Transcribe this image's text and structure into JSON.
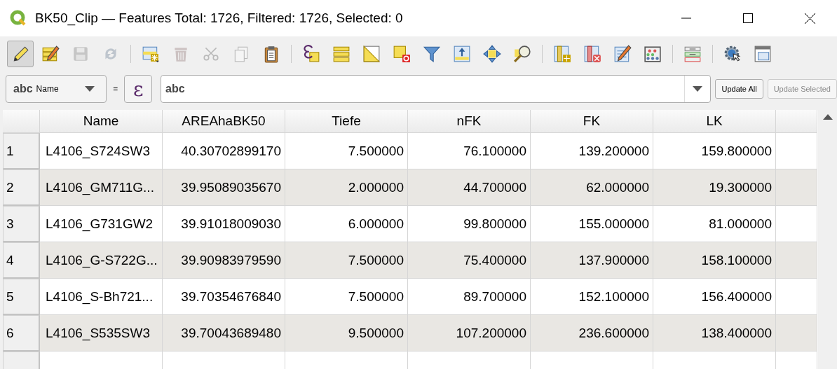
{
  "window": {
    "title": "BK50_Clip — Features Total: 1726, Filtered: 1726, Selected: 0"
  },
  "toolbar": [
    {
      "kind": "edit",
      "on": true,
      "disabled": false
    },
    {
      "kind": "multiedit",
      "on": false,
      "disabled": false
    },
    {
      "kind": "save",
      "on": false,
      "disabled": true
    },
    {
      "kind": "reload",
      "on": false,
      "disabled": true
    },
    {
      "kind": "separator"
    },
    {
      "kind": "newfeature",
      "on": false,
      "disabled": false
    },
    {
      "kind": "delete",
      "on": false,
      "disabled": true
    },
    {
      "kind": "cut",
      "on": false,
      "disabled": true
    },
    {
      "kind": "copy",
      "on": false,
      "disabled": true
    },
    {
      "kind": "paste",
      "on": false,
      "disabled": false
    },
    {
      "kind": "separator"
    },
    {
      "kind": "selectexpr",
      "on": false,
      "disabled": false
    },
    {
      "kind": "selectall",
      "on": false,
      "disabled": false
    },
    {
      "kind": "invert",
      "on": false,
      "disabled": false
    },
    {
      "kind": "deselect",
      "on": false,
      "disabled": false
    },
    {
      "kind": "filter",
      "on": false,
      "disabled": false
    },
    {
      "kind": "movetop",
      "on": false,
      "disabled": false
    },
    {
      "kind": "pan",
      "on": false,
      "disabled": false
    },
    {
      "kind": "zoom",
      "on": false,
      "disabled": false
    },
    {
      "kind": "separator"
    },
    {
      "kind": "addcol",
      "on": false,
      "disabled": false
    },
    {
      "kind": "delcol",
      "on": false,
      "disabled": false
    },
    {
      "kind": "calc",
      "on": false,
      "disabled": false
    },
    {
      "kind": "abacus",
      "on": false,
      "disabled": false
    },
    {
      "kind": "separator"
    },
    {
      "kind": "form",
      "on": false,
      "disabled": false
    },
    {
      "kind": "separator"
    },
    {
      "kind": "actions",
      "on": false,
      "disabled": false
    },
    {
      "kind": "dock",
      "on": false,
      "disabled": false
    }
  ],
  "filter_bar": {
    "field_type": "abc",
    "field": "Name",
    "operator": "=",
    "expression_button": "ε",
    "value": "abc",
    "buttons": [
      {
        "label": "Update All",
        "disabled": false
      },
      {
        "label": "Update Selected",
        "disabled": true
      }
    ]
  },
  "table": {
    "columns": [
      "Name",
      "AREAhaBK50",
      "Tiefe",
      "nFK",
      "FK",
      "LK"
    ],
    "rows": [
      {
        "header": "1",
        "cells": [
          "L4106_S724SW3",
          "40.30702899170",
          "7.500000",
          "76.100000",
          "139.200000",
          "159.800000"
        ]
      },
      {
        "header": "2",
        "cells": [
          "L4106_GM711G...",
          "39.95089035670",
          "2.000000",
          "44.700000",
          "62.000000",
          "19.300000"
        ]
      },
      {
        "header": "3",
        "cells": [
          "L4106_G731GW2",
          "39.91018009030",
          "6.000000",
          "99.800000",
          "155.000000",
          "81.000000"
        ]
      },
      {
        "header": "4",
        "cells": [
          "L4106_G-S722G...",
          "39.90983979590",
          "7.500000",
          "75.400000",
          "137.900000",
          "158.100000"
        ]
      },
      {
        "header": "5",
        "cells": [
          "L4106_S-Bh721...",
          "39.70354676840",
          "7.500000",
          "89.700000",
          "152.100000",
          "156.400000"
        ]
      },
      {
        "header": "6",
        "cells": [
          "L4106_S535SW3",
          "39.70043689480",
          "9.500000",
          "107.200000",
          "236.600000",
          "138.400000"
        ]
      }
    ]
  }
}
